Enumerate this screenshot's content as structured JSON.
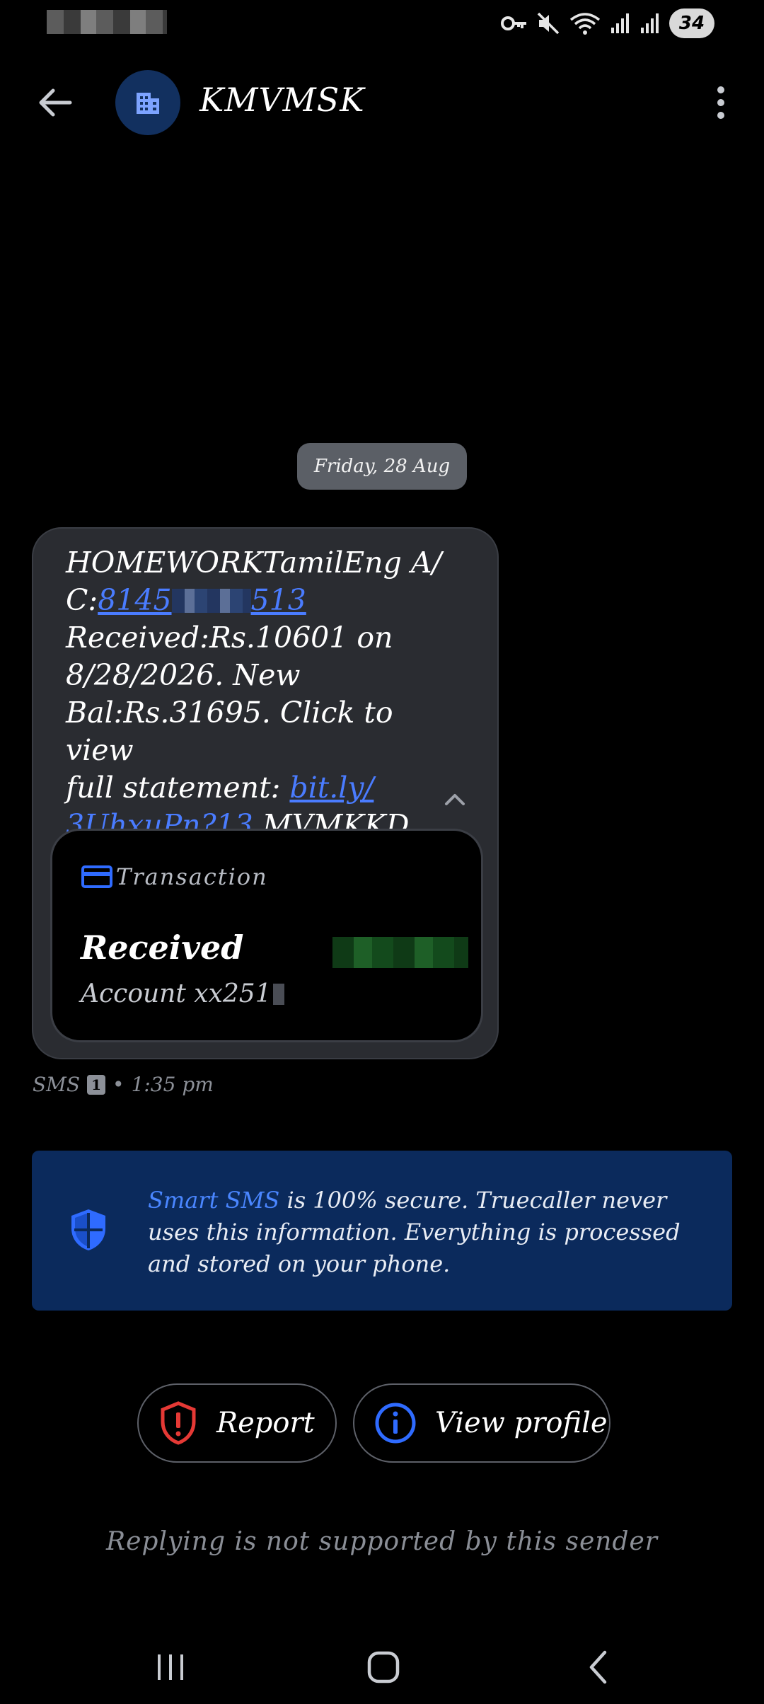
{
  "status_bar": {
    "battery_level": "34",
    "icons": [
      "key-icon",
      "mute-icon",
      "wifi-icon",
      "signal-icon",
      "signal-icon",
      "battery-icon"
    ]
  },
  "header": {
    "title": "KMVMSK",
    "avatar_icon": "building-icon",
    "back_icon": "arrow-left-icon",
    "menu_icon": "more-vertical-icon"
  },
  "date_separator": "Friday, 28 Aug",
  "message": {
    "line1": "HOMEWORKTamilEng A/",
    "account_prefix": "C:",
    "account_link_start": "8145",
    "account_link_end": "513",
    "line3": "Received:Rs.10601 on",
    "line4": "8/28/2026. New",
    "line5": "Bal:Rs.31695. Click to view",
    "line6_prefix": "full statement: ",
    "url_part1": "bit.ly/",
    "url_part2": "3UhxuPn?13",
    "suffix": " MVMKKD",
    "meta_channel": "SMS",
    "sim_slot": "1",
    "meta_separator": "•",
    "meta_time": "1:35 pm"
  },
  "transaction_card": {
    "header_icon": "credit-card-icon",
    "header_label": "Transaction",
    "status": "Received",
    "account": "Account xx251"
  },
  "smart_sms_banner": {
    "icon": "shield-icon",
    "highlight": "Smart SMS",
    "text": " is 100% secure. Truecaller never uses this information. Everything is processed and stored on your phone."
  },
  "actions": {
    "report_label": "Report",
    "report_icon": "shield-alert-icon",
    "profile_label": "View profile",
    "profile_icon": "info-icon"
  },
  "footer_note": "Replying is not supported by this sender",
  "colors": {
    "background": "#000000",
    "bubble": "#2a2c31",
    "link": "#4a7cff",
    "banner": "#0b2a5c",
    "report_red": "#e53935",
    "info_blue": "#2f6bff"
  },
  "nav_bar": {
    "icons": [
      "recent-apps-icon",
      "home-icon",
      "back-icon"
    ]
  }
}
